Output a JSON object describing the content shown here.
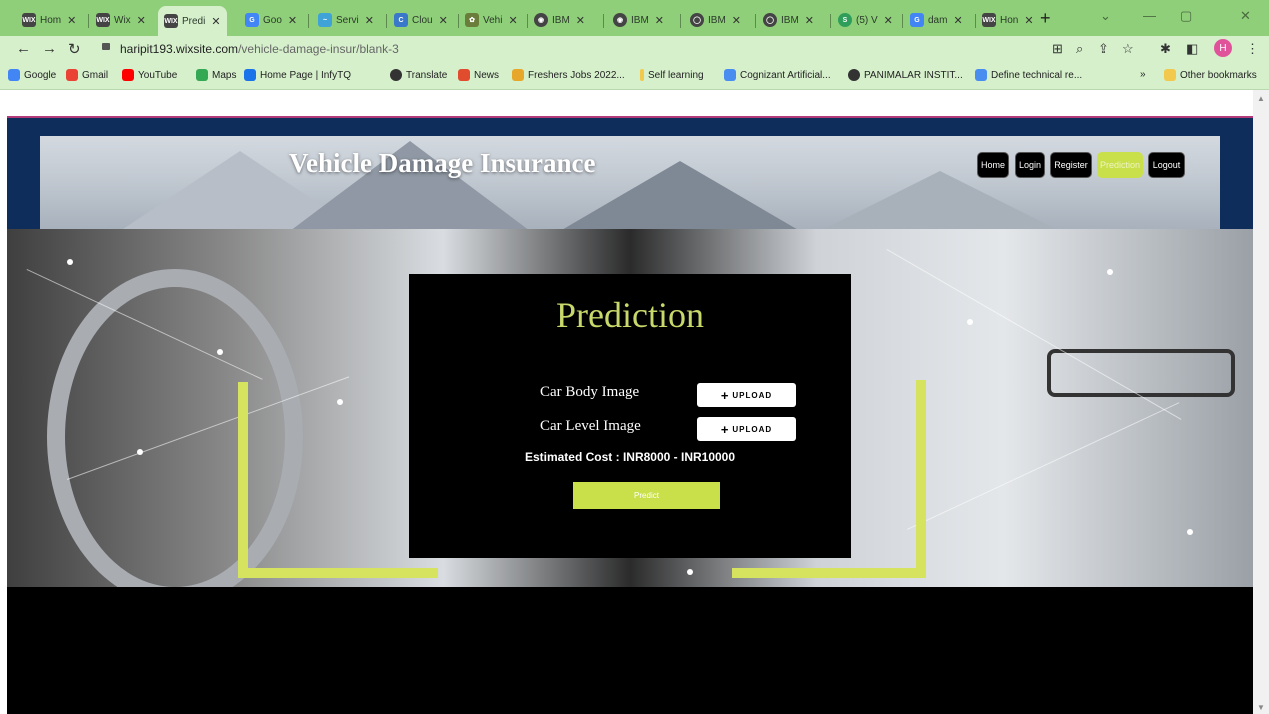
{
  "browser": {
    "tabs": [
      {
        "favicon": "WIX",
        "title": "Hom",
        "active": false
      },
      {
        "favicon": "WIX",
        "title": "Wix",
        "active": false
      },
      {
        "favicon": "WIX",
        "title": "Predi",
        "active": true
      },
      {
        "favicon": "G",
        "title": "Goo",
        "active": false
      },
      {
        "favicon": "~",
        "title": "Servi",
        "active": false
      },
      {
        "favicon": "C",
        "title": "Clou",
        "active": false
      },
      {
        "favicon": "✿",
        "title": "Vehi",
        "active": false
      },
      {
        "favicon": "◉",
        "title": "IBM",
        "active": false
      },
      {
        "favicon": "◉",
        "title": "IBM",
        "active": false
      },
      {
        "favicon": "◯",
        "title": "IBM",
        "active": false
      },
      {
        "favicon": "◯",
        "title": "IBM",
        "active": false
      },
      {
        "favicon": "S",
        "title": "(5) V",
        "active": false
      },
      {
        "favicon": "G",
        "title": "dam",
        "active": false
      },
      {
        "favicon": "WIX",
        "title": "Hon",
        "active": false
      }
    ],
    "url_host": "haripit193.wixsite.com",
    "url_path": "/vehicle-damage-insur/blank-3",
    "avatar_letter": "H",
    "bookmarks": [
      {
        "label": "Google",
        "color": "#4285f4"
      },
      {
        "label": "Gmail",
        "color": "#ea4335"
      },
      {
        "label": "YouTube",
        "color": "#ff0000"
      },
      {
        "label": "Maps",
        "color": "#34a853"
      },
      {
        "label": "Home Page | InfyTQ",
        "color": "#1a73e8"
      },
      {
        "label": "Translate",
        "color": "#333333"
      },
      {
        "label": "News",
        "color": "#e24c2e"
      },
      {
        "label": "Freshers Jobs 2022...",
        "color": "#e6a72a"
      },
      {
        "label": "Self learning",
        "color": "#f2c94c"
      },
      {
        "label": "Cognizant Artificial...",
        "color": "#4a8df0"
      },
      {
        "label": "PANIMALAR INSTIT...",
        "color": "#333333"
      },
      {
        "label": "Define technical re...",
        "color": "#4a8df0"
      }
    ],
    "bookmarks_overflow": "»",
    "other_bookmarks": "Other bookmarks"
  },
  "site": {
    "title": "Vehicle Damage Insurance",
    "nav": [
      {
        "label": "Home",
        "active": false
      },
      {
        "label": "Login",
        "active": false
      },
      {
        "label": "Register",
        "active": false
      },
      {
        "label": "Prediction",
        "active": true
      },
      {
        "label": "Logout",
        "active": false
      }
    ],
    "accent_color": "#c9e04a",
    "header_color": "#0e2d5a"
  },
  "prediction": {
    "heading": "Prediction",
    "car_body_label": "Car Body Image",
    "car_level_label": "Car Level Image",
    "upload_label": "UPLOAD",
    "estimated_cost": "Estimated Cost : INR8000 - INR10000",
    "predict_label": "Predict"
  }
}
